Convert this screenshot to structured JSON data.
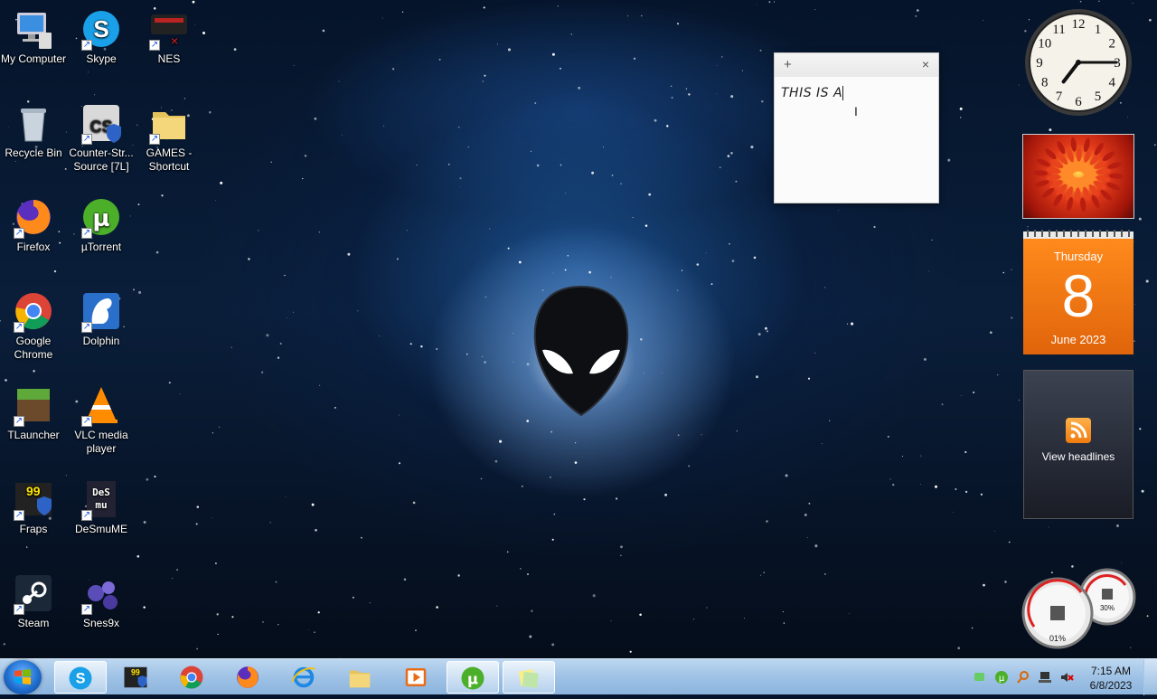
{
  "desktop": {
    "icons": [
      {
        "label": "My Computer",
        "icon": "computer-icon"
      },
      {
        "label": "Skype",
        "icon": "skype-icon"
      },
      {
        "label": "NES",
        "icon": "nes-icon"
      },
      {
        "label": "Recycle Bin",
        "icon": "recycle-bin-icon"
      },
      {
        "label": "Counter-Str... Source [7L]",
        "icon": "counter-strike-icon"
      },
      {
        "label": "GAMES - Shortcut",
        "icon": "folder-icon"
      },
      {
        "label": "Firefox",
        "icon": "firefox-icon"
      },
      {
        "label": "µTorrent",
        "icon": "utorrent-icon"
      },
      {
        "label": "Google Chrome",
        "icon": "chrome-icon"
      },
      {
        "label": "Dolphin",
        "icon": "dolphin-icon"
      },
      {
        "label": "TLauncher",
        "icon": "tlauncher-icon"
      },
      {
        "label": "VLC media player",
        "icon": "vlc-icon"
      },
      {
        "label": "Fraps",
        "icon": "fraps-icon"
      },
      {
        "label": "DeSmuME",
        "icon": "desmume-icon"
      },
      {
        "label": "Steam",
        "icon": "steam-icon"
      },
      {
        "label": "Snes9x",
        "icon": "snes9x-icon"
      }
    ]
  },
  "sticky_note": {
    "add_label": "+",
    "close_label": "×",
    "text": "THIS IS A"
  },
  "gadgets": {
    "clock": {
      "hour": 7,
      "minute": 15
    },
    "calendar": {
      "weekday": "Thursday",
      "day": "8",
      "month_year": "June 2023"
    },
    "feeds": {
      "label": "View headlines"
    },
    "meter": {
      "cpu": "01%",
      "memory": "30%"
    }
  },
  "taskbar": {
    "pinned": [
      {
        "name": "skype",
        "icon": "skype-icon",
        "active": true
      },
      {
        "name": "fraps",
        "icon": "fraps-icon",
        "active": false
      },
      {
        "name": "chrome",
        "icon": "chrome-icon",
        "active": false
      },
      {
        "name": "firefox",
        "icon": "firefox-icon",
        "active": false
      },
      {
        "name": "internet-explorer",
        "icon": "ie-icon",
        "active": false
      },
      {
        "name": "explorer",
        "icon": "folder-icon",
        "active": false
      },
      {
        "name": "media-player",
        "icon": "media-player-icon",
        "active": false
      },
      {
        "name": "utorrent",
        "icon": "utorrent-icon",
        "active": true
      },
      {
        "name": "sticky-notes",
        "icon": "sticky-notes-icon",
        "active": true
      }
    ],
    "clock": {
      "time": "7:15 AM",
      "date": "6/8/2023"
    }
  }
}
